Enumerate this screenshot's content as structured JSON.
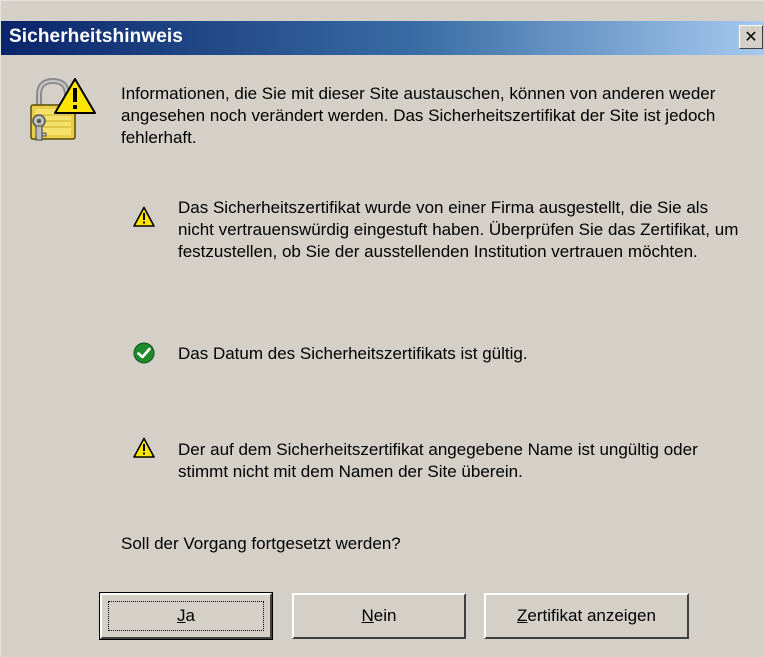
{
  "window": {
    "title": "Sicherheitshinweis",
    "close_label": "✕"
  },
  "main": {
    "intro_text": "Informationen, die Sie mit dieser Site austauschen, können von anderen weder angesehen noch verändert werden. Das Sicherheitszertifikat der Site ist jedoch fehlerhaft.",
    "items": [
      {
        "status": "warning",
        "icon": "warning-icon",
        "text": "Das Sicherheitszertifikat wurde von einer Firma ausgestellt, die Sie als nicht vertrauenswürdig eingestuft haben. Überprüfen Sie das Zertifikat, um festzustellen, ob Sie der ausstellenden Institution vertrauen möchten."
      },
      {
        "status": "ok",
        "icon": "checkmark-icon",
        "text": "Das Datum des Sicherheitszertifikats ist gültig."
      },
      {
        "status": "warning",
        "icon": "warning-icon",
        "text": "Der auf dem Sicherheitszertifikat angegebene Name ist ungültig oder stimmt nicht mit dem Namen der Site überein."
      }
    ],
    "question": "Soll der Vorgang fortgesetzt werden?"
  },
  "buttons": {
    "ja": {
      "mnemonic": "J",
      "rest": "a"
    },
    "nein": {
      "mnemonic": "N",
      "rest": "ein"
    },
    "zertifikat": {
      "mnemonic": "Z",
      "rest": "ertifikat anzeigen"
    }
  },
  "colors": {
    "title_bar_start": "#0a246a",
    "title_bar_end": "#a6caf0",
    "dialog_bg": "#d4d0c8",
    "warning_yellow": "#ffe600",
    "ok_green": "#1e8a2e"
  }
}
